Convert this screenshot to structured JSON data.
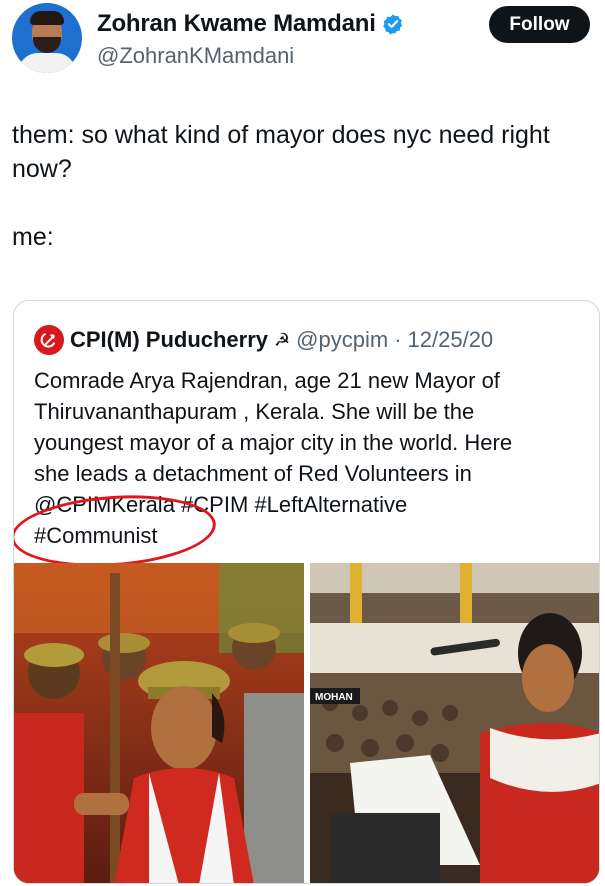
{
  "author": {
    "name": "Zohran Kwame Mamdani",
    "handle": "@ZohranKMamdani",
    "verified_color": "#1d9bf0"
  },
  "follow_label": "Follow",
  "tweet": {
    "lines": [
      "them: so what kind of mayor does nyc need right now?",
      "me:"
    ]
  },
  "quote": {
    "name": "CPI(M) Puducherry",
    "symbol": "☭",
    "handle": "@pycpim",
    "separator": "·",
    "date": "12/25/20",
    "text_lines": [
      "Comrade Arya Rajendran, age 21  new Mayor of",
      "Thiruvananthapuram , Kerala. She will be the",
      "youngest mayor of a major city in the world. Here",
      "she leads a detachment of Red Volunteers in",
      "@CPIMKerala  #CPIM  #LeftAlternative",
      "#Communist"
    ],
    "photos": [
      {
        "icon": "woman-in-red-volunteer-uniform-photo"
      },
      {
        "icon": "woman-speaking-at-council-podium-photo",
        "caption": "MOHAN"
      }
    ],
    "annotation_color": "#e5141b"
  }
}
